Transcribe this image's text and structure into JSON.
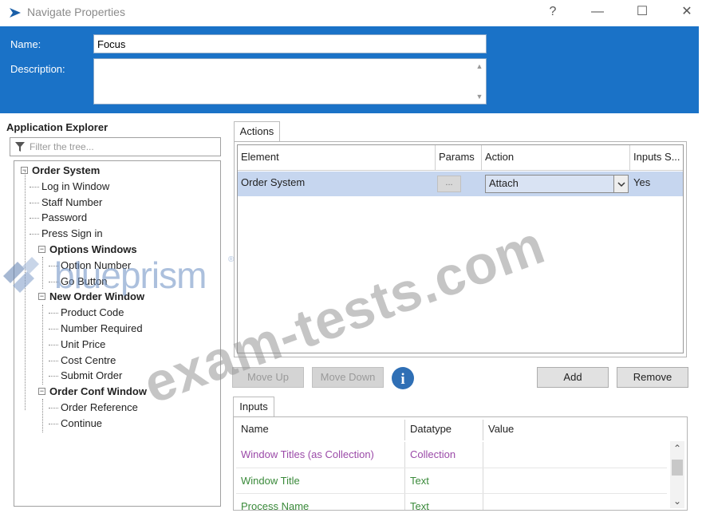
{
  "window": {
    "title": "Navigate Properties",
    "help_glyph": "?",
    "minimize_glyph": "—",
    "maximize_glyph": "☐",
    "close_glyph": "✕"
  },
  "header": {
    "name_label": "Name:",
    "name_value": "Focus",
    "description_label": "Description:",
    "description_value": ""
  },
  "explorer": {
    "title": "Application Explorer",
    "filter_placeholder": "Filter the tree...",
    "tree": [
      {
        "label": "Order System",
        "level": 0,
        "bold": true,
        "expander": "−"
      },
      {
        "label": "Log in Window",
        "level": 1,
        "bold": false
      },
      {
        "label": "Staff Number",
        "level": 1,
        "bold": false
      },
      {
        "label": "Password",
        "level": 1,
        "bold": false
      },
      {
        "label": "Press Sign in",
        "level": 1,
        "bold": false
      },
      {
        "label": "Options Windows",
        "level": 1,
        "bold": true,
        "expander": "−"
      },
      {
        "label": "Option Number",
        "level": 2,
        "bold": false
      },
      {
        "label": "Go Button",
        "level": 2,
        "bold": false
      },
      {
        "label": "New Order Window",
        "level": 1,
        "bold": true,
        "expander": "−"
      },
      {
        "label": "Product Code",
        "level": 2,
        "bold": false
      },
      {
        "label": "Number Required",
        "level": 2,
        "bold": false
      },
      {
        "label": "Unit Price",
        "level": 2,
        "bold": false
      },
      {
        "label": "Cost Centre",
        "level": 2,
        "bold": false
      },
      {
        "label": "Submit Order",
        "level": 2,
        "bold": false
      },
      {
        "label": "Order Conf Window",
        "level": 1,
        "bold": true,
        "expander": "−"
      },
      {
        "label": "Order Reference",
        "level": 2,
        "bold": false
      },
      {
        "label": "Continue",
        "level": 2,
        "bold": false
      }
    ]
  },
  "actions": {
    "tab_label": "Actions",
    "columns": [
      "Element",
      "Params",
      "Action",
      "Inputs S..."
    ],
    "rows": [
      {
        "element": "Order System",
        "params": "...",
        "action": "Attach",
        "inputs_set": "Yes"
      }
    ],
    "dropdown_glyph": "▾",
    "move_up_label": "Move Up",
    "move_down_label": "Move Down",
    "info_glyph": "i",
    "add_label": "Add",
    "remove_label": "Remove"
  },
  "inputs": {
    "tab_label": "Inputs",
    "columns": [
      "Name",
      "Datatype",
      "Value"
    ],
    "rows": [
      {
        "name": "Window Titles (as Collection)",
        "datatype": "Collection",
        "value": "",
        "color": "#9b4aa8"
      },
      {
        "name": "Window Title",
        "datatype": "Text",
        "value": "",
        "color": "#3a8a3a"
      },
      {
        "name": "Process Name",
        "datatype": "Text",
        "value": "",
        "color": "#3a8a3a"
      }
    ],
    "scroll_up_glyph": "⌃",
    "scroll_down_glyph": "⌄"
  },
  "watermarks": {
    "logo_text": "blueprism",
    "logo_mark": "®",
    "site_text": "exam-tests.com"
  },
  "colors": {
    "header_blue": "#1a72c7",
    "selection": "#c6d6ef",
    "info_blue": "#2f6fb5"
  }
}
